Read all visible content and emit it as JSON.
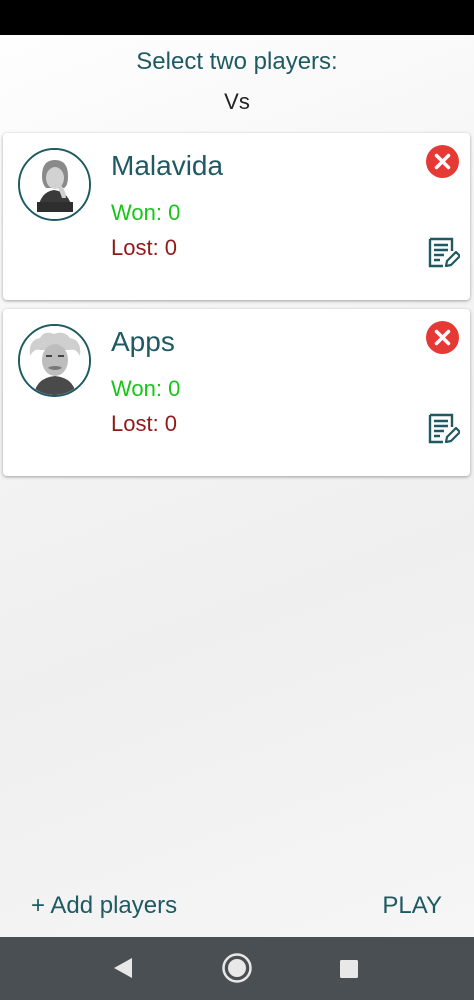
{
  "header": {
    "title": "Select two players:",
    "vs": "Vs"
  },
  "players": [
    {
      "name": "Malavida",
      "won": "Won: 0",
      "lost": "Lost: 0",
      "avatar_icon": "woman-portrait-icon"
    },
    {
      "name": "Apps",
      "won": "Won: 0",
      "lost": "Lost: 0",
      "avatar_icon": "einstein-portrait-icon"
    }
  ],
  "actions": {
    "add_players": "+ Add players",
    "play": "PLAY"
  },
  "colors": {
    "accent": "#1f5a63",
    "won": "#19c519",
    "lost": "#8e1a1a",
    "delete": "#e53935",
    "nav_bar": "#4a4f54"
  },
  "icons": [
    "close-icon",
    "edit-note-icon",
    "back-icon",
    "home-icon",
    "recents-icon"
  ]
}
